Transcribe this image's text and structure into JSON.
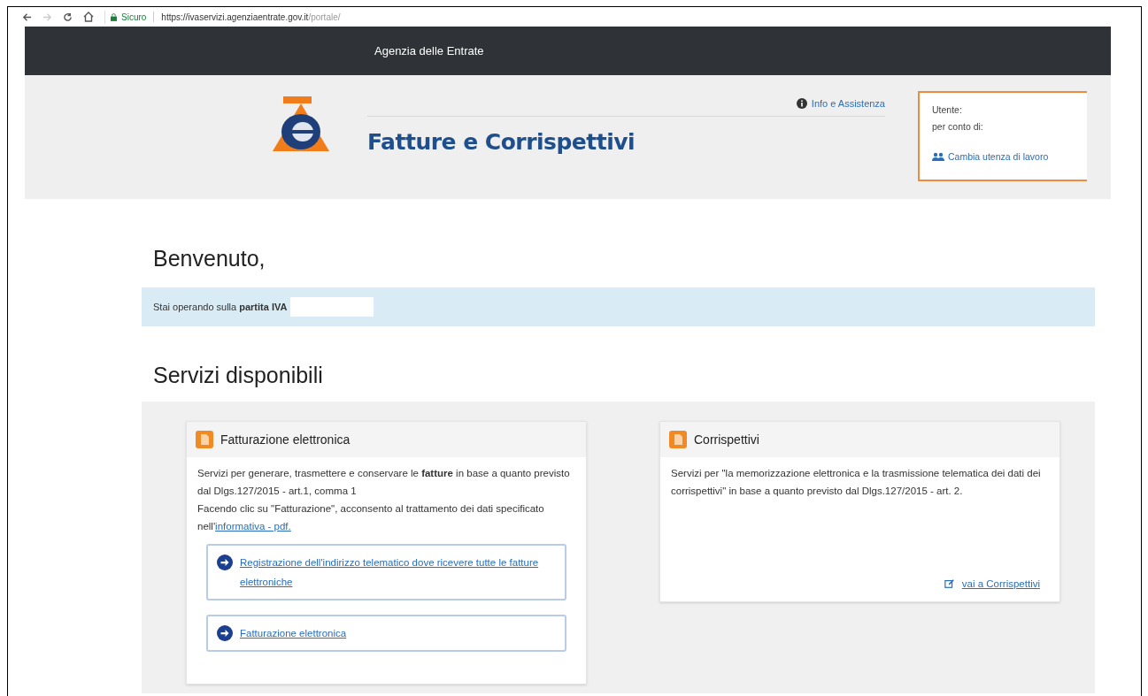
{
  "browser": {
    "secure_label": "Sicuro",
    "url_host": "https://ivaservizi.agenziaentrate.gov.it",
    "url_path": "/portale/"
  },
  "top_bar": {
    "title": "Agenzia delle Entrate"
  },
  "header": {
    "title": "Fatture e Corrispettivi",
    "help_link": "Info e Assistenza",
    "user_box": {
      "user_label": "Utente:",
      "on_behalf_label": "per conto di:",
      "switch_link": "Cambia utenza di lavoro"
    }
  },
  "welcome": "Benvenuto,",
  "vat_notice": {
    "text": "Stai operando sulla **partita IVA**"
  },
  "services_title": "Servizi disponibili",
  "services": [
    {
      "title": "Fatturazione elettronica",
      "paragraphs": [
        "Servizi per generare, trasmettere e conservare le **fatture** in base a quanto previsto dal Dlgs.127/2015 - art.1, comma 1",
        "Facendo clic su \"Fatturazione\", acconsento al trattamento dei dati specificato nell'"
      ],
      "inline_link": "informativa - pdf.",
      "actions": [
        {
          "kind": "boxed",
          "label": "Registrazione dell'indirizzo telematico dove ricevere tutte le fatture elettroniche"
        },
        {
          "kind": "boxed",
          "label": "Fatturazione elettronica"
        }
      ]
    },
    {
      "title": "Corrispettivi",
      "paragraphs": [
        "Servizi per \"la memorizzazione elettronica e la trasmissione telematica dei dati dei corrispettivi\" in base a quanto previsto dal Dlgs.127/2015 - art. 2."
      ],
      "actions": [
        {
          "kind": "plain",
          "label": "vai a Corrispettivi"
        }
      ]
    }
  ]
}
